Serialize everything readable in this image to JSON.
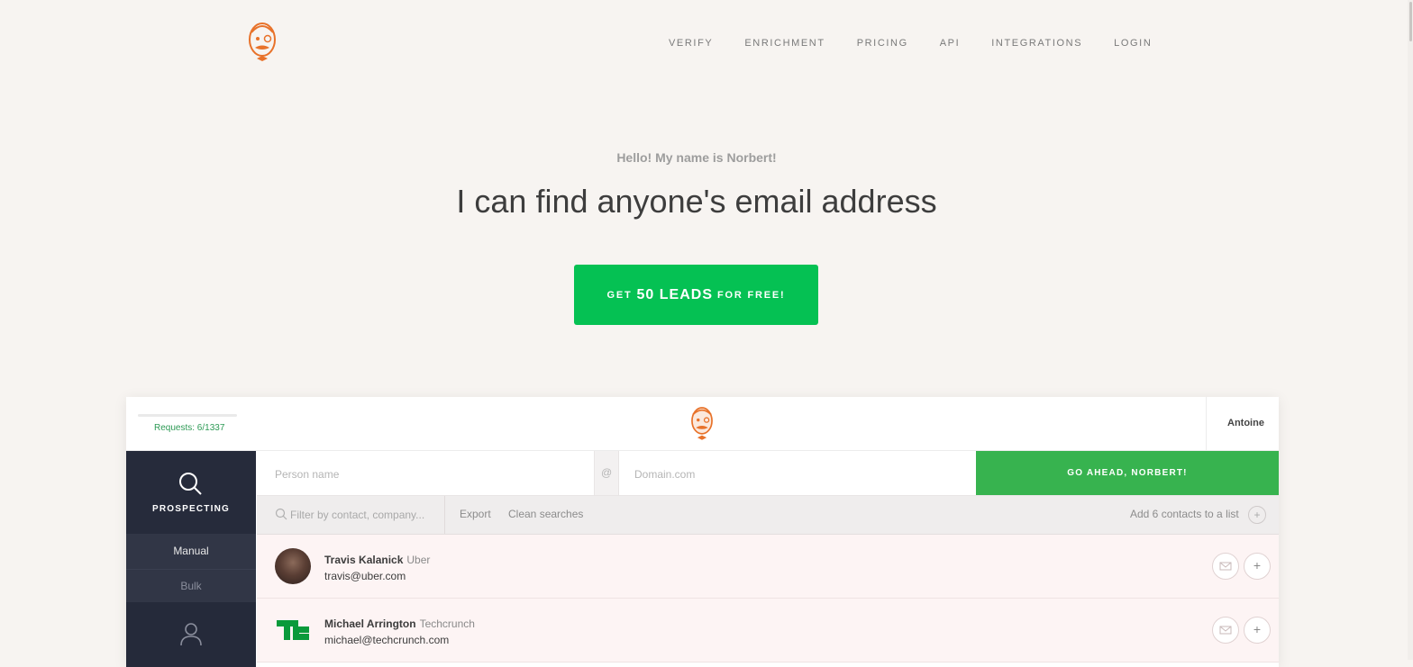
{
  "nav": {
    "items": [
      "VERIFY",
      "ENRICHMENT",
      "PRICING",
      "API",
      "INTEGRATIONS",
      "LOGIN"
    ]
  },
  "hero": {
    "greeting": "Hello! My name is Norbert!",
    "headline": "I can find anyone's email address",
    "cta": {
      "prefix": "GET",
      "emphasis": "50 LEADS",
      "suffix": "FOR FREE!"
    }
  },
  "app": {
    "requests": "Requests: 6/1337",
    "user": "Antoine",
    "sidebar": {
      "prospecting": "PROSPECTING",
      "manual": "Manual",
      "bulk": "Bulk"
    },
    "search": {
      "person_placeholder": "Person name",
      "at": "@",
      "domain_placeholder": "Domain.com",
      "go_label": "GO AHEAD, NORBERT!"
    },
    "toolbar": {
      "filter_placeholder": "Filter by contact, company...",
      "export": "Export",
      "clean": "Clean searches",
      "add_to_list": "Add 6 contacts to a list"
    },
    "contacts": [
      {
        "name": "Travis Kalanick",
        "company": "Uber",
        "email": "travis@uber.com"
      },
      {
        "name": "Michael Arrington",
        "company": "Techcrunch",
        "email": "michael@techcrunch.com"
      }
    ]
  },
  "colors": {
    "accent": "#05c153",
    "logo": "#e8722a",
    "sidebar": "#252a3a"
  }
}
